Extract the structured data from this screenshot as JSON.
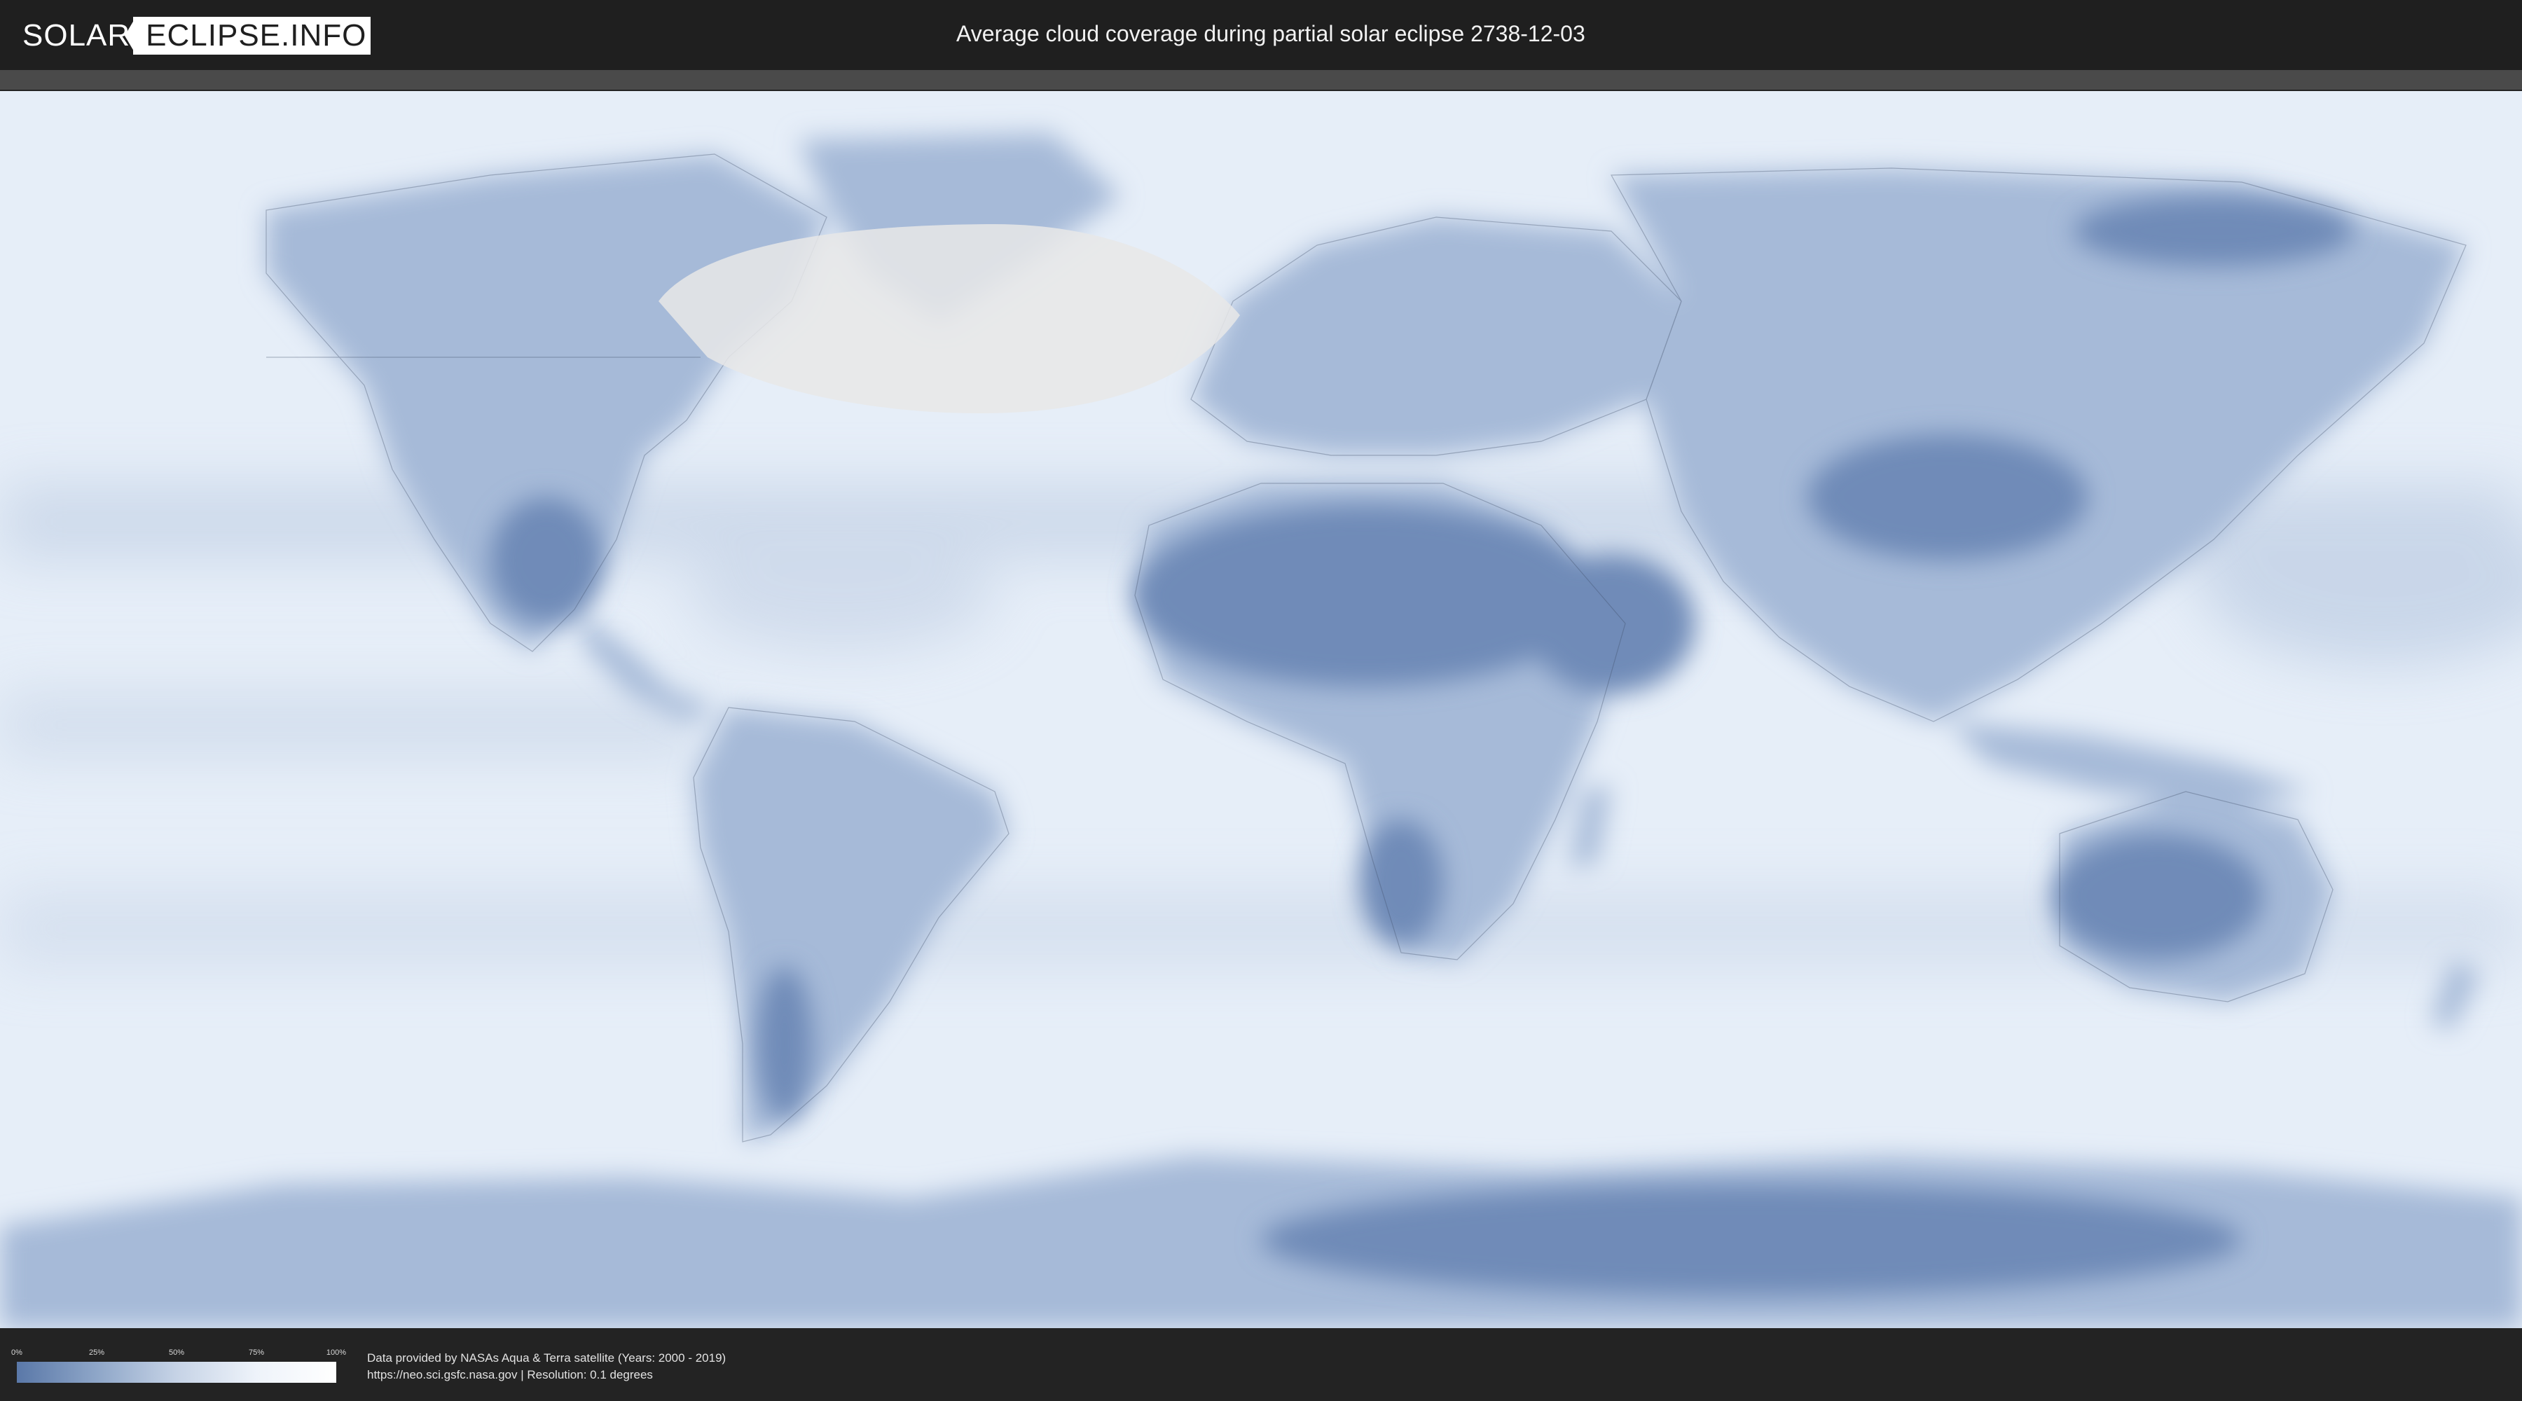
{
  "header": {
    "logo_left": "SOLAR",
    "logo_right": "ECLIPSE.INFO",
    "title": "Average cloud coverage during partial solar eclipse 2738-12-03"
  },
  "map": {
    "ocean_color": "#e6eef8",
    "land_color": "#a6bad8",
    "dry_region_color": "#6f8bb8",
    "eclipse_zone_color": "#e8e8e8",
    "border_color": "#3c4a63"
  },
  "legend": {
    "ticks": [
      "0%",
      "25%",
      "50%",
      "75%",
      "100%"
    ],
    "colors": [
      "#5a78a8",
      "#8ea6c8",
      "#c6d3e6",
      "#eef3fa",
      "#ffffff"
    ]
  },
  "footer": {
    "credit_line_1": "Data provided by NASAs Aqua & Terra satellite (Years: 2000 - 2019)",
    "credit_line_2": "https://neo.sci.gsfc.nasa.gov | Resolution: 0.1 degrees"
  }
}
